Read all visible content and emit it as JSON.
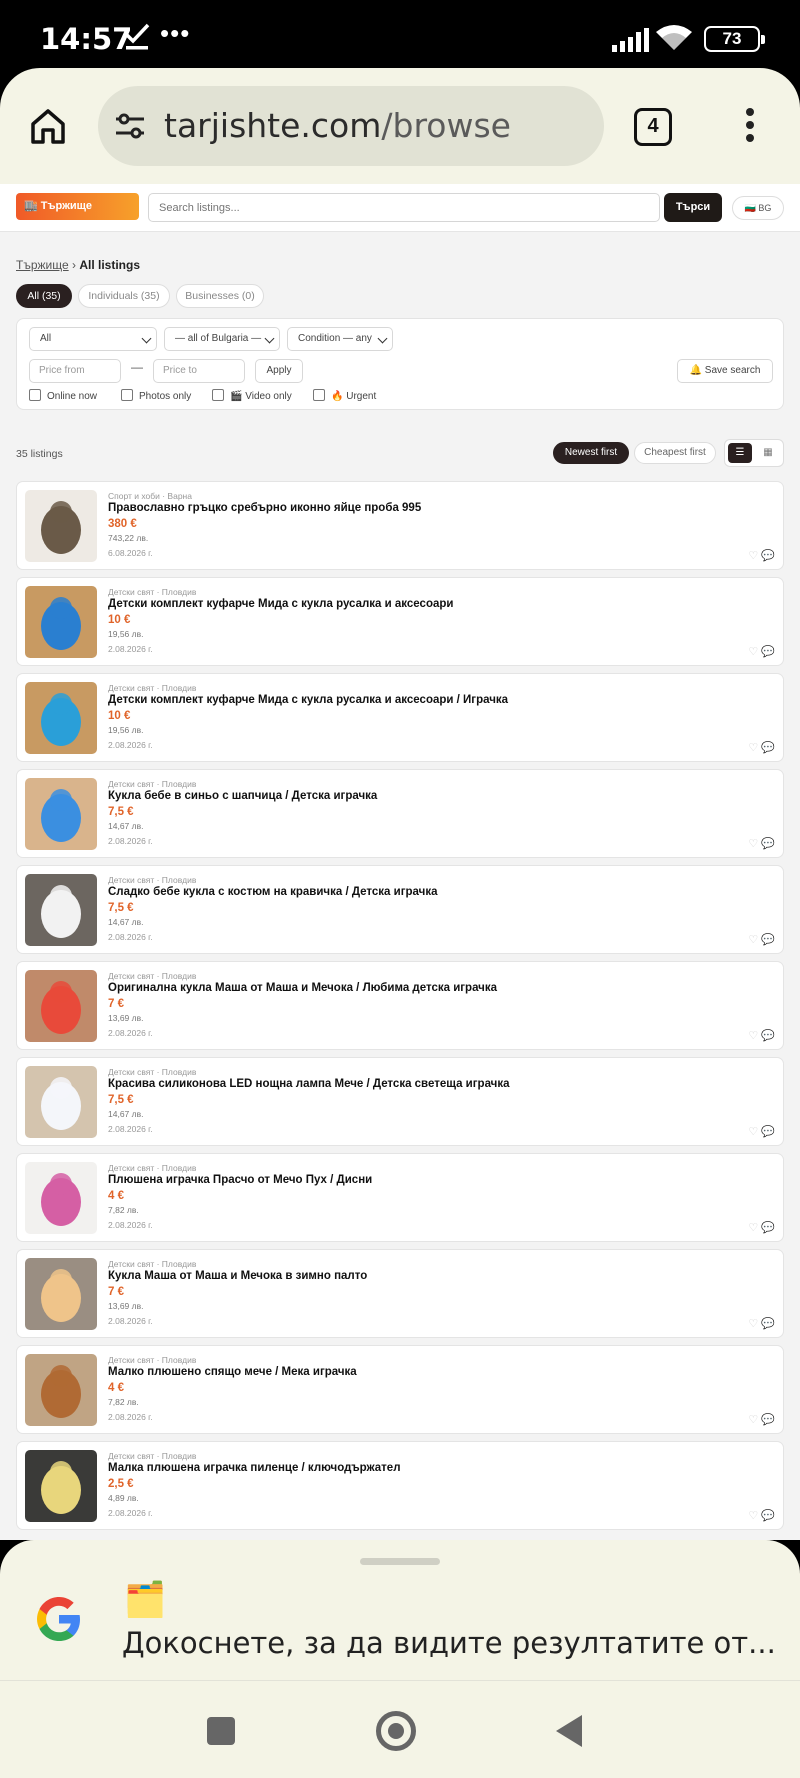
{
  "status_bar": {
    "time": "14:57",
    "dots": "•••",
    "battery": "73"
  },
  "browser": {
    "url_domain": "tarjishte.com",
    "url_path": "/browse",
    "tab_count": "4"
  },
  "site": {
    "logo": "🏬 Тържище",
    "search_placeholder": "Search listings...",
    "search_button": "Търси",
    "language": "🇧🇬 BG"
  },
  "breadcrumb": {
    "root": "Тържище",
    "separator": "›",
    "current": "All listings"
  },
  "segments": [
    "All (35)",
    "Individuals (35)",
    "Businesses (0)"
  ],
  "filters": {
    "category": "All",
    "region": "— all of Bulgaria —",
    "condition": "Condition — any",
    "price_from": "Price from",
    "price_to": "Price to",
    "dash": "—",
    "apply": "Apply",
    "save_search": "🔔 Save search",
    "checkboxes": [
      "Online now",
      "Photos only",
      "🎬 Video only",
      "🔥 Urgent"
    ]
  },
  "results": {
    "count": "35 listings",
    "sort_newest": "Newest first",
    "sort_cheapest": "Cheapest first",
    "view_list": "☰",
    "view_grid": "▦"
  },
  "listings": [
    {
      "meta": "Спорт и хоби · Варна",
      "title": "Православно гръцко сребърно иконно яйце проба 995",
      "price": "380 €",
      "lev": "743,22 лв.",
      "date": "6.08.2026 г."
    },
    {
      "meta": "Детски свят · Пловдив",
      "title": "Детски комплект куфарче Мида с кукла русалка и аксесоари",
      "price": "10 €",
      "lev": "19,56 лв.",
      "date": "2.08.2026 г."
    },
    {
      "meta": "Детски свят · Пловдив",
      "title": "Детски комплект куфарче Мида с кукла русалка и аксесоари / Играчка",
      "price": "10 €",
      "lev": "19,56 лв.",
      "date": "2.08.2026 г."
    },
    {
      "meta": "Детски свят · Пловдив",
      "title": "Кукла бебе в синьо с шапчица / Детска играчка",
      "price": "7,5 €",
      "lev": "14,67 лв.",
      "date": "2.08.2026 г."
    },
    {
      "meta": "Детски свят · Пловдив",
      "title": "Сладко бебе кукла с костюм на кравичка / Детска играчка",
      "price": "7,5 €",
      "lev": "14,67 лв.",
      "date": "2.08.2026 г."
    },
    {
      "meta": "Детски свят · Пловдив",
      "title": "Оригинална кукла Маша от Маша и Мечока / Любима детска играчка",
      "price": "7 €",
      "lev": "13,69 лв.",
      "date": "2.08.2026 г."
    },
    {
      "meta": "Детски свят · Пловдив",
      "title": "Красива силиконова LED нощна лампа Мече / Детска светеща играчка",
      "price": "7,5 €",
      "lev": "14,67 лв.",
      "date": "2.08.2026 г."
    },
    {
      "meta": "Детски свят · Пловдив",
      "title": "Плюшена играчка Прасчо от Мечо Пух / Дисни",
      "price": "4 €",
      "lev": "7,82 лв.",
      "date": "2.08.2026 г."
    },
    {
      "meta": "Детски свят · Пловдив",
      "title": "Кукла Маша от Маша и Мечока в зимно палто",
      "price": "7 €",
      "lev": "13,69 лв.",
      "date": "2.08.2026 г."
    },
    {
      "meta": "Детски свят · Пловдив",
      "title": "Малко плюшено спящо мече / Мека играчка",
      "price": "4 €",
      "lev": "7,82 лв.",
      "date": "2.08.2026 г."
    },
    {
      "meta": "Детски свят · Пловдив",
      "title": "Малка плюшена играчка пиленце / ключодържател",
      "price": "2,5 €",
      "lev": "4,89 лв.",
      "date": "2.08.2026 г."
    }
  ],
  "thumb_colors": [
    [
      "#eeeae4",
      "#6a5a48"
    ],
    [
      "#c89a62",
      "#2a7fd0"
    ],
    [
      "#c89a62",
      "#2a9fd8"
    ],
    [
      "#d9b48c",
      "#3b8fe0"
    ],
    [
      "#6c6660",
      "#f2f2f2"
    ],
    [
      "#c08a6a",
      "#e84a3a"
    ],
    [
      "#d4c4ae",
      "#f4f6fa"
    ],
    [
      "#f2f1ef",
      "#d55fa4"
    ],
    [
      "#9a8e82",
      "#efc48a"
    ],
    [
      "#c0a484",
      "#b06a34"
    ],
    [
      "#3a3a38",
      "#e8d67c"
    ]
  ],
  "google_sheet": {
    "folder": "🗂️",
    "text": "Докоснете, за да видите резултатите от..."
  }
}
